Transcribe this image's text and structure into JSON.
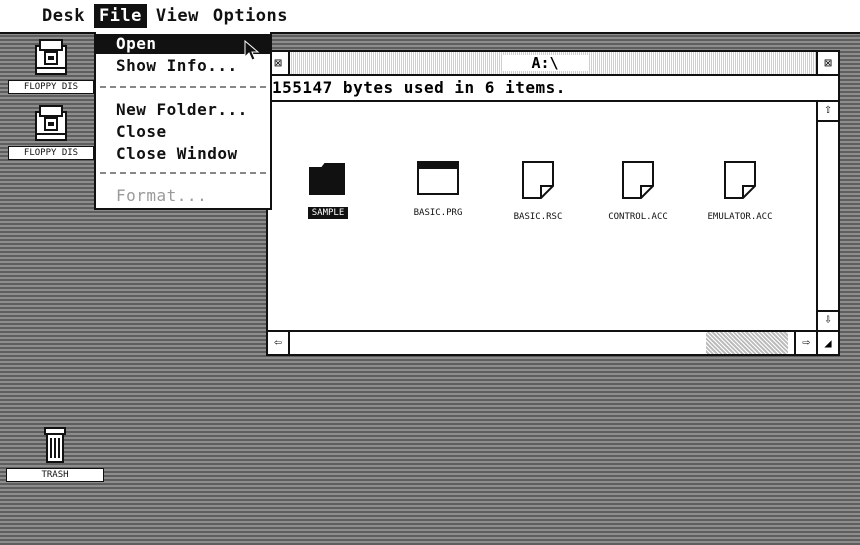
{
  "menubar": {
    "items": [
      "Desk",
      "File",
      "View",
      "Options"
    ],
    "active": "File"
  },
  "file_menu": {
    "items": [
      {
        "label": "Open",
        "highlighted": true,
        "enabled": true
      },
      {
        "label": "Show Info...",
        "highlighted": false,
        "enabled": true
      },
      {
        "label": "New Folder...",
        "highlighted": false,
        "enabled": true
      },
      {
        "label": "Close",
        "highlighted": false,
        "enabled": true
      },
      {
        "label": "Close Window",
        "highlighted": false,
        "enabled": true
      },
      {
        "label": "Format...",
        "highlighted": false,
        "enabled": false
      }
    ]
  },
  "desktop": {
    "icons": [
      {
        "label": "FLOPPY DIS",
        "icon": "floppy-drive-icon"
      },
      {
        "label": "FLOPPY DIS",
        "icon": "floppy-drive-icon"
      },
      {
        "label": "TRASH",
        "icon": "trash-icon"
      }
    ]
  },
  "window": {
    "title": "A:\\",
    "info": "155147 bytes used in 6 items.",
    "close_glyph": "⊠",
    "full_glyph": "⊠",
    "files": [
      {
        "label": "SAMPLE",
        "type": "folder",
        "selected": true
      },
      {
        "label": "BASIC.PRG",
        "type": "program",
        "selected": false
      },
      {
        "label": "BASIC.RSC",
        "type": "document",
        "selected": false
      },
      {
        "label": "CONTROL.ACC",
        "type": "document",
        "selected": false
      },
      {
        "label": "EMULATOR.ACC",
        "type": "document",
        "selected": false
      }
    ],
    "scroll": {
      "up": "⇧",
      "down": "⇩",
      "left": "⇦",
      "right": "⇨",
      "size": "◢"
    }
  }
}
